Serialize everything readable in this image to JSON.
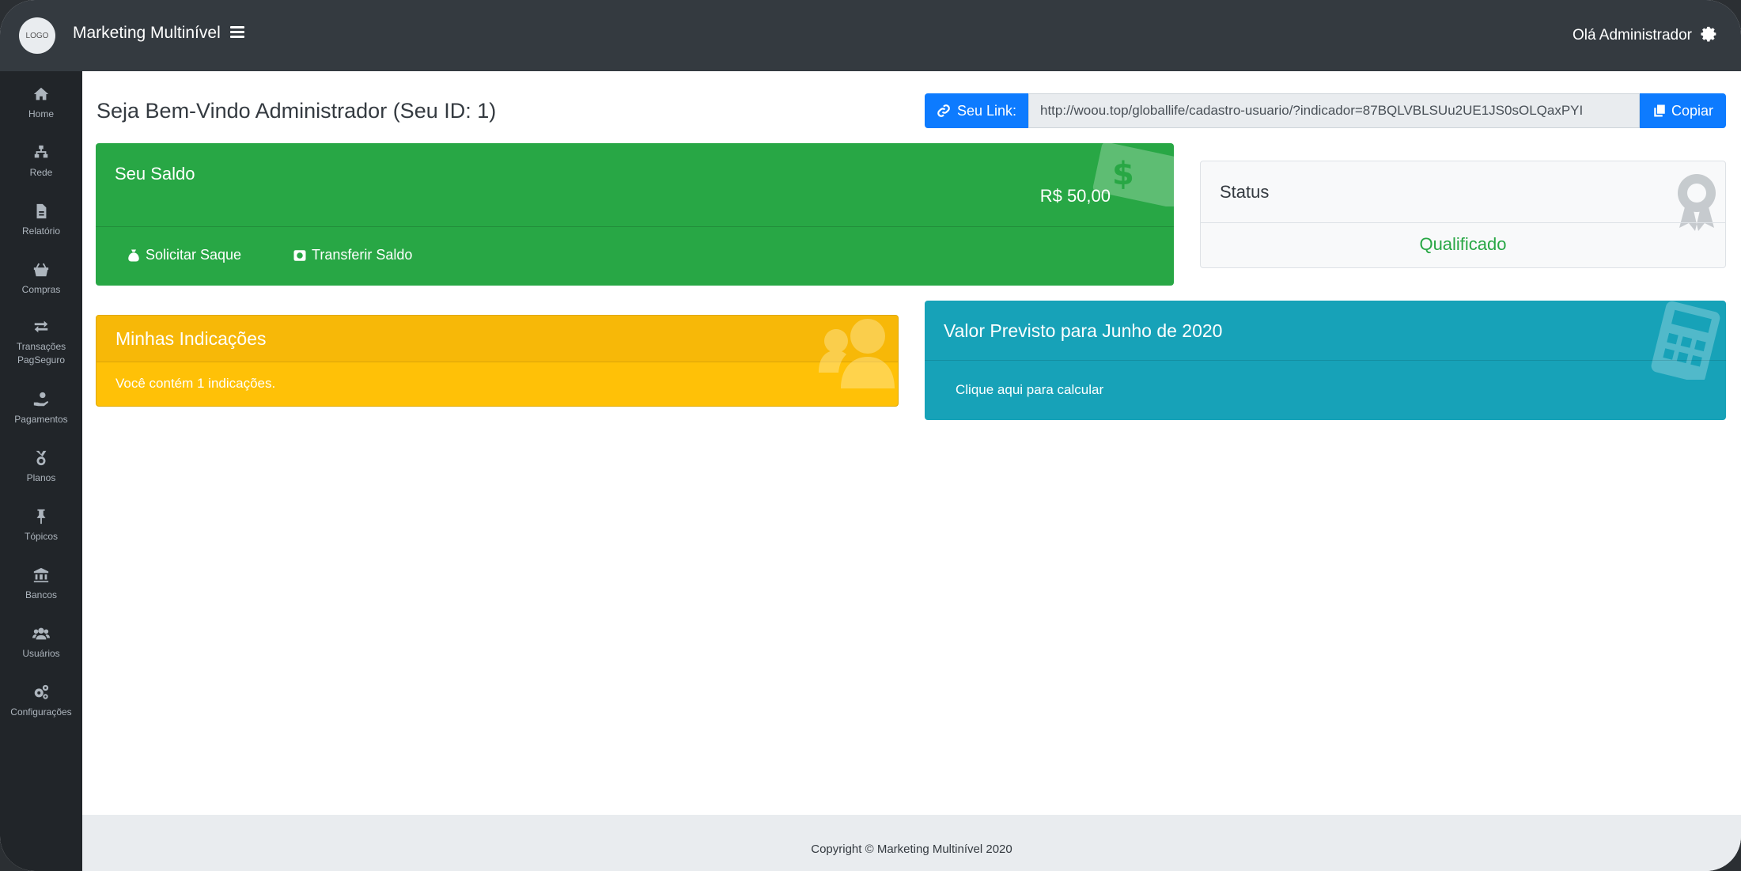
{
  "header": {
    "logo_text": "LOGO",
    "brand": "Marketing Multinível",
    "greeting": "Olá Administrador"
  },
  "sidebar": {
    "items": [
      {
        "label": "Home",
        "icon": "home-icon"
      },
      {
        "label": "Rede",
        "icon": "network-icon"
      },
      {
        "label": "Relatório",
        "icon": "report-icon"
      },
      {
        "label": "Compras",
        "icon": "basket-icon"
      },
      {
        "label": "Transações",
        "label2": "PagSeguro",
        "icon": "exchange-icon"
      },
      {
        "label": "Pagamentos",
        "icon": "hand-coin-icon"
      },
      {
        "label": "Planos",
        "icon": "medal-icon"
      },
      {
        "label": "Tópicos",
        "icon": "pin-icon"
      },
      {
        "label": "Bancos",
        "icon": "bank-icon"
      },
      {
        "label": "Usuários",
        "icon": "users-icon"
      },
      {
        "label": "Configurações",
        "icon": "cogs-icon"
      }
    ]
  },
  "main": {
    "title": "Seja Bem-Vindo Administrador (Seu ID: 1)",
    "link": {
      "label": "Seu Link:",
      "value": "http://woou.top/globallife/cadastro-usuario/?indicador=87BQLVBLSUu2UE1JS0sOLQaxPYI",
      "copy_label": "Copiar"
    },
    "saldo": {
      "title": "Seu Saldo",
      "amount": "R$ 50,00",
      "actions": [
        "Solicitar Saque",
        "Transferir Saldo"
      ]
    },
    "status": {
      "title": "Status",
      "value": "Qualificado"
    },
    "indicacoes": {
      "title": "Minhas Indicações",
      "text": "Você contém 1 indicações."
    },
    "previsto": {
      "title": "Valor Previsto para Junho de 2020",
      "link": "Clique aqui para calcular"
    }
  },
  "footer": {
    "copyright": "Copyright © Marketing Multinível 2020"
  },
  "colors": {
    "topbar": "#343a40",
    "sidebar": "#212529",
    "primary": "#0d7bff",
    "success": "#28a745",
    "warning": "#ffc107",
    "info": "#17a2b8"
  }
}
